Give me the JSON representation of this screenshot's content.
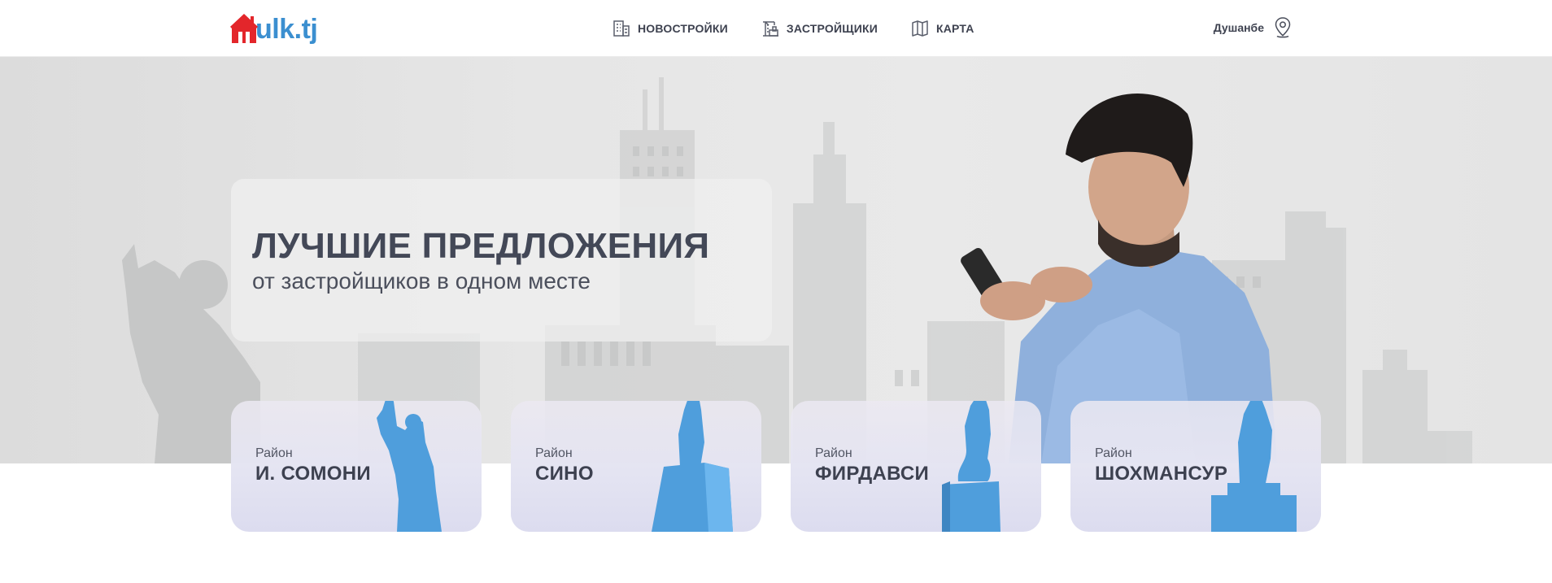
{
  "header": {
    "logo": {
      "mark": "m",
      "text": "ulk.tj",
      "color_red": "#e3262b",
      "color_blue": "#3b8fd0"
    },
    "nav": [
      {
        "label": "НОВОСТРОЙКИ",
        "icon": "building-icon"
      },
      {
        "label": "ЗАСТРОЙЩИКИ",
        "icon": "crane-icon"
      },
      {
        "label": "КАРТА",
        "icon": "map-icon"
      }
    ],
    "city": {
      "label": "Душанбе",
      "icon": "location-pin-icon"
    }
  },
  "hero": {
    "title": "ЛУЧШИЕ ПРЕДЛОЖЕНИЯ",
    "subtitle": "от застройщиков в одном месте"
  },
  "districts": [
    {
      "label": "Район",
      "name": "И. СОМОНИ",
      "icon": "statue-somoni-icon"
    },
    {
      "label": "Район",
      "name": "СИНО",
      "icon": "statue-sino-icon"
    },
    {
      "label": "Район",
      "name": "ФИРДАВСИ",
      "icon": "statue-firdavsi-icon"
    },
    {
      "label": "Район",
      "name": "ШОХМАНСУР",
      "icon": "statue-shohmansur-icon"
    }
  ],
  "colors": {
    "accent_blue": "#4f9edc",
    "text_dark": "#3e4250"
  }
}
